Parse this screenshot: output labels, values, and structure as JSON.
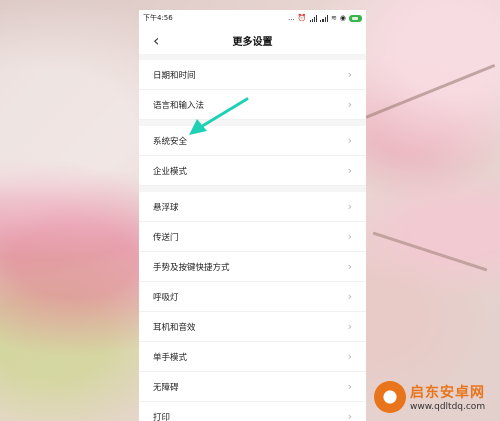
{
  "statusbar": {
    "time": "下午4:56",
    "icons": [
      "alarm-icon",
      "signal-icon",
      "signal-icon",
      "wifi-icon",
      "location-icon",
      "battery-icon"
    ],
    "extra": "..."
  },
  "header": {
    "back_icon": "chevron-left-icon",
    "title": "更多设置"
  },
  "groups": [
    {
      "items": [
        {
          "label": "日期和时间"
        },
        {
          "label": "语言和输入法"
        }
      ]
    },
    {
      "items": [
        {
          "label": "系统安全"
        },
        {
          "label": "企业模式"
        }
      ]
    },
    {
      "items": [
        {
          "label": "悬浮球"
        },
        {
          "label": "传送门"
        },
        {
          "label": "手势及按键快捷方式"
        },
        {
          "label": "呼吸灯"
        },
        {
          "label": "耳机和音效"
        },
        {
          "label": "单手模式"
        },
        {
          "label": "无障碍"
        },
        {
          "label": "打印"
        }
      ]
    }
  ],
  "annotation": {
    "color": "#1fd1b4",
    "target": "系统安全"
  },
  "watermark": {
    "title": "启东安卓网",
    "url": "www.qdltdq.com",
    "color": "#e8741b"
  }
}
